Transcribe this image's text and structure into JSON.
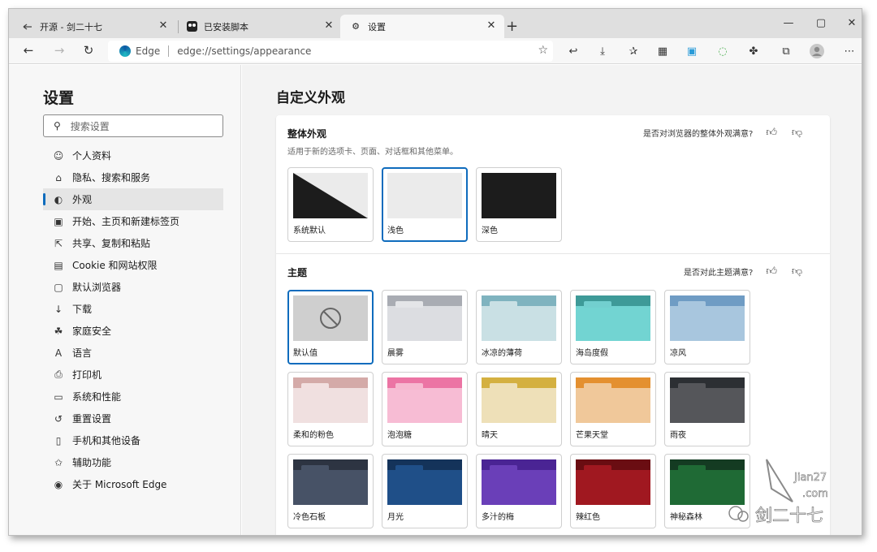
{
  "tabs": [
    {
      "title": "开源 - 剑二十七",
      "icon": "repo-icon"
    },
    {
      "title": "已安装脚本",
      "icon": "tampermonkey-icon"
    },
    {
      "title": "设置",
      "icon": "gear-icon"
    }
  ],
  "address": {
    "edge_label": "Edge",
    "url": "edge://settings/appearance"
  },
  "sidebar": {
    "title": "设置",
    "search_placeholder": "搜索设置",
    "items": [
      {
        "label": "个人资料",
        "icon": "profile-icon",
        "glyph": "☺"
      },
      {
        "label": "隐私、搜索和服务",
        "icon": "lock-icon",
        "glyph": "⌂"
      },
      {
        "label": "外观",
        "icon": "palette-icon",
        "glyph": "◐"
      },
      {
        "label": "开始、主页和新建标签页",
        "icon": "home-tabs-icon",
        "glyph": "▣"
      },
      {
        "label": "共享、复制和粘贴",
        "icon": "share-icon",
        "glyph": "⇱"
      },
      {
        "label": "Cookie 和网站权限",
        "icon": "site-permissions-icon",
        "glyph": "▤"
      },
      {
        "label": "默认浏览器",
        "icon": "default-browser-icon",
        "glyph": "▢"
      },
      {
        "label": "下载",
        "icon": "download-icon",
        "glyph": "↓"
      },
      {
        "label": "家庭安全",
        "icon": "family-icon",
        "glyph": "☘"
      },
      {
        "label": "语言",
        "icon": "language-icon",
        "glyph": "A"
      },
      {
        "label": "打印机",
        "icon": "printer-icon",
        "glyph": "⎙"
      },
      {
        "label": "系统和性能",
        "icon": "system-icon",
        "glyph": "▭"
      },
      {
        "label": "重置设置",
        "icon": "reset-icon",
        "glyph": "↺"
      },
      {
        "label": "手机和其他设备",
        "icon": "phone-icon",
        "glyph": "▯"
      },
      {
        "label": "辅助功能",
        "icon": "accessibility-icon",
        "glyph": "✩"
      },
      {
        "label": "关于 Microsoft Edge",
        "icon": "edge-logo-icon",
        "glyph": "◉"
      }
    ],
    "selected_index": 2
  },
  "main": {
    "title": "自定义外观",
    "overall": {
      "title": "整体外观",
      "desc": "适用于新的选项卡、页面、对话框和其他菜单。",
      "feedback": "是否对浏览器的整体外观满意?",
      "options": [
        {
          "label": "系统默认",
          "kind": "system"
        },
        {
          "label": "浅色",
          "kind": "light"
        },
        {
          "label": "深色",
          "kind": "dark"
        }
      ],
      "selected": 1
    },
    "themes": {
      "title": "主题",
      "feedback": "是否对此主题满意?",
      "items": [
        {
          "label": "默认值",
          "bar": "#cfcfcf",
          "tab": "#cfcfcf",
          "body": "#cfcfcf",
          "kind": "default"
        },
        {
          "label": "晨雾",
          "bar": "#a9acb3",
          "tab": "#e4e5e8",
          "body": "#dcdde1"
        },
        {
          "label": "冰凉的薄荷",
          "bar": "#7fb3bf",
          "tab": "#c9e0e4",
          "body": "#c9e0e4"
        },
        {
          "label": "海岛度假",
          "bar": "#3e9a98",
          "tab": "#72cfcf",
          "body": "#72d4d2"
        },
        {
          "label": "凉风",
          "bar": "#6f9cc4",
          "tab": "#a8c6de",
          "body": "#a8c6de"
        },
        {
          "label": "柔和的粉色",
          "bar": "#d4aaa8",
          "tab": "#f2e0e0",
          "body": "#f0e0e0"
        },
        {
          "label": "泡泡糖",
          "bar": "#ec74a4",
          "tab": "#f7b8d0",
          "body": "#f7bcd4"
        },
        {
          "label": "晴天",
          "bar": "#d4b040",
          "tab": "#eee0b8",
          "body": "#eee0b8"
        },
        {
          "label": "芒果天堂",
          "bar": "#e49030",
          "tab": "#f0c89a",
          "body": "#f0c89a"
        },
        {
          "label": "雨夜",
          "bar": "#2c2f33",
          "tab": "#55565a",
          "body": "#55565a"
        },
        {
          "label": "冷色石板",
          "bar": "#2d3442",
          "tab": "#475266",
          "body": "#475266"
        },
        {
          "label": "月光",
          "bar": "#14335a",
          "tab": "#1f4f88",
          "body": "#1f4f88"
        },
        {
          "label": "多汁的梅",
          "bar": "#4a2494",
          "tab": "#6a3fb8",
          "body": "#6a3fb8"
        },
        {
          "label": "辣红色",
          "bar": "#6a0d12",
          "tab": "#a01820",
          "body": "#a01820"
        },
        {
          "label": "神秘森林",
          "bar": "#143b22",
          "tab": "#1f6a35",
          "body": "#1f6a35"
        }
      ],
      "selected": 0
    }
  },
  "watermark": {
    "line1": "Jian27",
    "line2": ".com",
    "brand": "剑二十七"
  },
  "colors": {
    "accent": "#0f6cbd"
  }
}
